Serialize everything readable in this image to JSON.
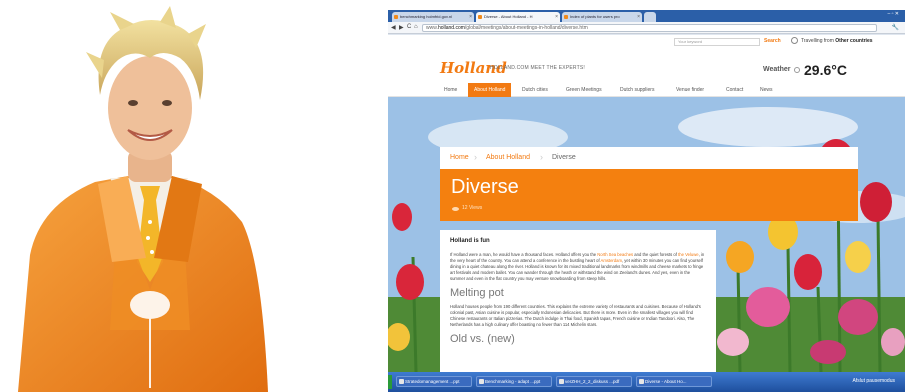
{
  "browser": {
    "tabs": [
      {
        "label": "benchmarking holmfrid.gov.nl"
      },
      {
        "label": "Diverse - About Holland - H"
      },
      {
        "label": "Index of plants for users pro"
      }
    ],
    "window_controls": "– ▫ ✕",
    "url_prefix": "www.",
    "url_host": "holland.com",
    "url_path": "/global/meetings/about-meetings-in-holland/diverse.htm",
    "nav_back": "◀",
    "nav_forward": "▶",
    "nav_reload": "C",
    "nav_home": "⌂",
    "wrench": "🔧"
  },
  "site": {
    "search_placeholder": "Your keyword",
    "search_button": "Search",
    "travel_prefix": "Travelling from",
    "travel_country": "Other countries",
    "logo": "Holland",
    "logo_tagline": "HOLLAND.COM MEET THE EXPERTS!",
    "weather_label": "Weather",
    "weather_temp": "29.6°C",
    "nav": [
      {
        "label": "Home"
      },
      {
        "label": "About Holland"
      },
      {
        "label": "Dutch cities"
      },
      {
        "label": "Green Meetings"
      },
      {
        "label": "Dutch suppliers"
      },
      {
        "label": "Venue finder"
      },
      {
        "label": "Contact"
      },
      {
        "label": "News"
      }
    ],
    "breadcrumbs": [
      {
        "label": "Home"
      },
      {
        "label": "About Holland"
      },
      {
        "label": "Diverse"
      }
    ],
    "page_title": "Diverse",
    "views": "12 Views",
    "article": {
      "heading": "Holland is fun",
      "p1_a": "If Holland were a man, he would have a thousand faces. Holland offers you the ",
      "p1_link1": "North Sea beaches",
      "p1_b": " and the quiet forests of ",
      "p1_link2": "the Veluwe",
      "p1_c": ", in the very heart of the country. You can attend a conference in the bustling heart of ",
      "p1_link3": "Amsterdam",
      "p1_d": ", yet within 30 minutes you can find yourself dining in a quiet chateau along the river. Holland is known for its mixed traditional landmarks from windmills and cheese markets to fringe art festivals and modern ballet. You can wander through the heath or withstand the wind on Zeeland's dunes. And yes, even in the summer and even in the flat country you may venture snowboarding from steep hills.",
      "subheading": "Melting pot",
      "p2": "Holland houses people from 190 different countries. This explains the extreme variety of restaurants and cuisines. Because of Holland's colonial past, Asian cuisine is popular, especially Indonesian delicacies. But there is more. Even in the smallest villages you will find Chinese restaurants or Italian pizzerias. The Dutch indulge in Thai food, Spanish tapas, French cuisine or Indian Tandoori. Also, The Netherlands has a high culinary offer boasting no fewer than 114 Michelin stars.",
      "subheading2": "Old vs. (new)"
    }
  },
  "taskbar": {
    "items": [
      {
        "label": "Stratedomanagement ...ppt"
      },
      {
        "label": "Benchmarking - adapt ...ppt"
      },
      {
        "label": "verZHH_2_2_diskuss ...pdf"
      },
      {
        "label": "Diverse - About Ho..."
      }
    ],
    "right_text": "Afslut pausemodus"
  },
  "colors": {
    "accent": "#f27a12",
    "hero": "#f4800f",
    "suit": "#f08a1c"
  }
}
